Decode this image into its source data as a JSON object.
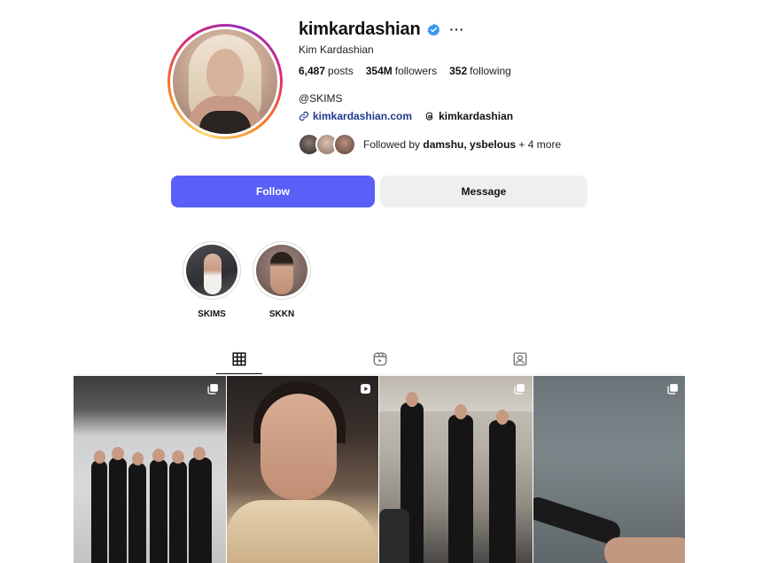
{
  "profile": {
    "username": "kimkardashian",
    "full_name": "Kim Kardashian",
    "verified": true,
    "more_icon": "more-horizontal-icon",
    "stats": {
      "posts_count": "6,487",
      "posts_label": "posts",
      "followers_count": "354M",
      "followers_label": "followers",
      "following_count": "352",
      "following_label": "following"
    },
    "bio_handle": "@SKIMS",
    "website": "kimkardashian.com",
    "threads_handle": "kimkardashian",
    "followed_by": {
      "prefix": "Followed by",
      "names": "damshu, ysbelous",
      "suffix": "+ 4 more"
    }
  },
  "actions": {
    "follow_label": "Follow",
    "message_label": "Message"
  },
  "highlights": [
    {
      "label": "SKIMS"
    },
    {
      "label": "SKKN"
    }
  ],
  "tabs": [
    {
      "name": "posts",
      "icon": "grid-icon",
      "active": true
    },
    {
      "name": "reels",
      "icon": "reels-icon",
      "active": false
    },
    {
      "name": "tagged",
      "icon": "tagged-icon",
      "active": false
    }
  ],
  "posts": [
    {
      "badge": "carousel-icon"
    },
    {
      "badge": "video-icon"
    },
    {
      "badge": "carousel-icon"
    },
    {
      "badge": "carousel-icon"
    }
  ],
  "colors": {
    "follow_button": "#5a5ff7",
    "message_button": "#efefef",
    "verified_badge": "#3897f0",
    "link": "#1e3a8a"
  }
}
